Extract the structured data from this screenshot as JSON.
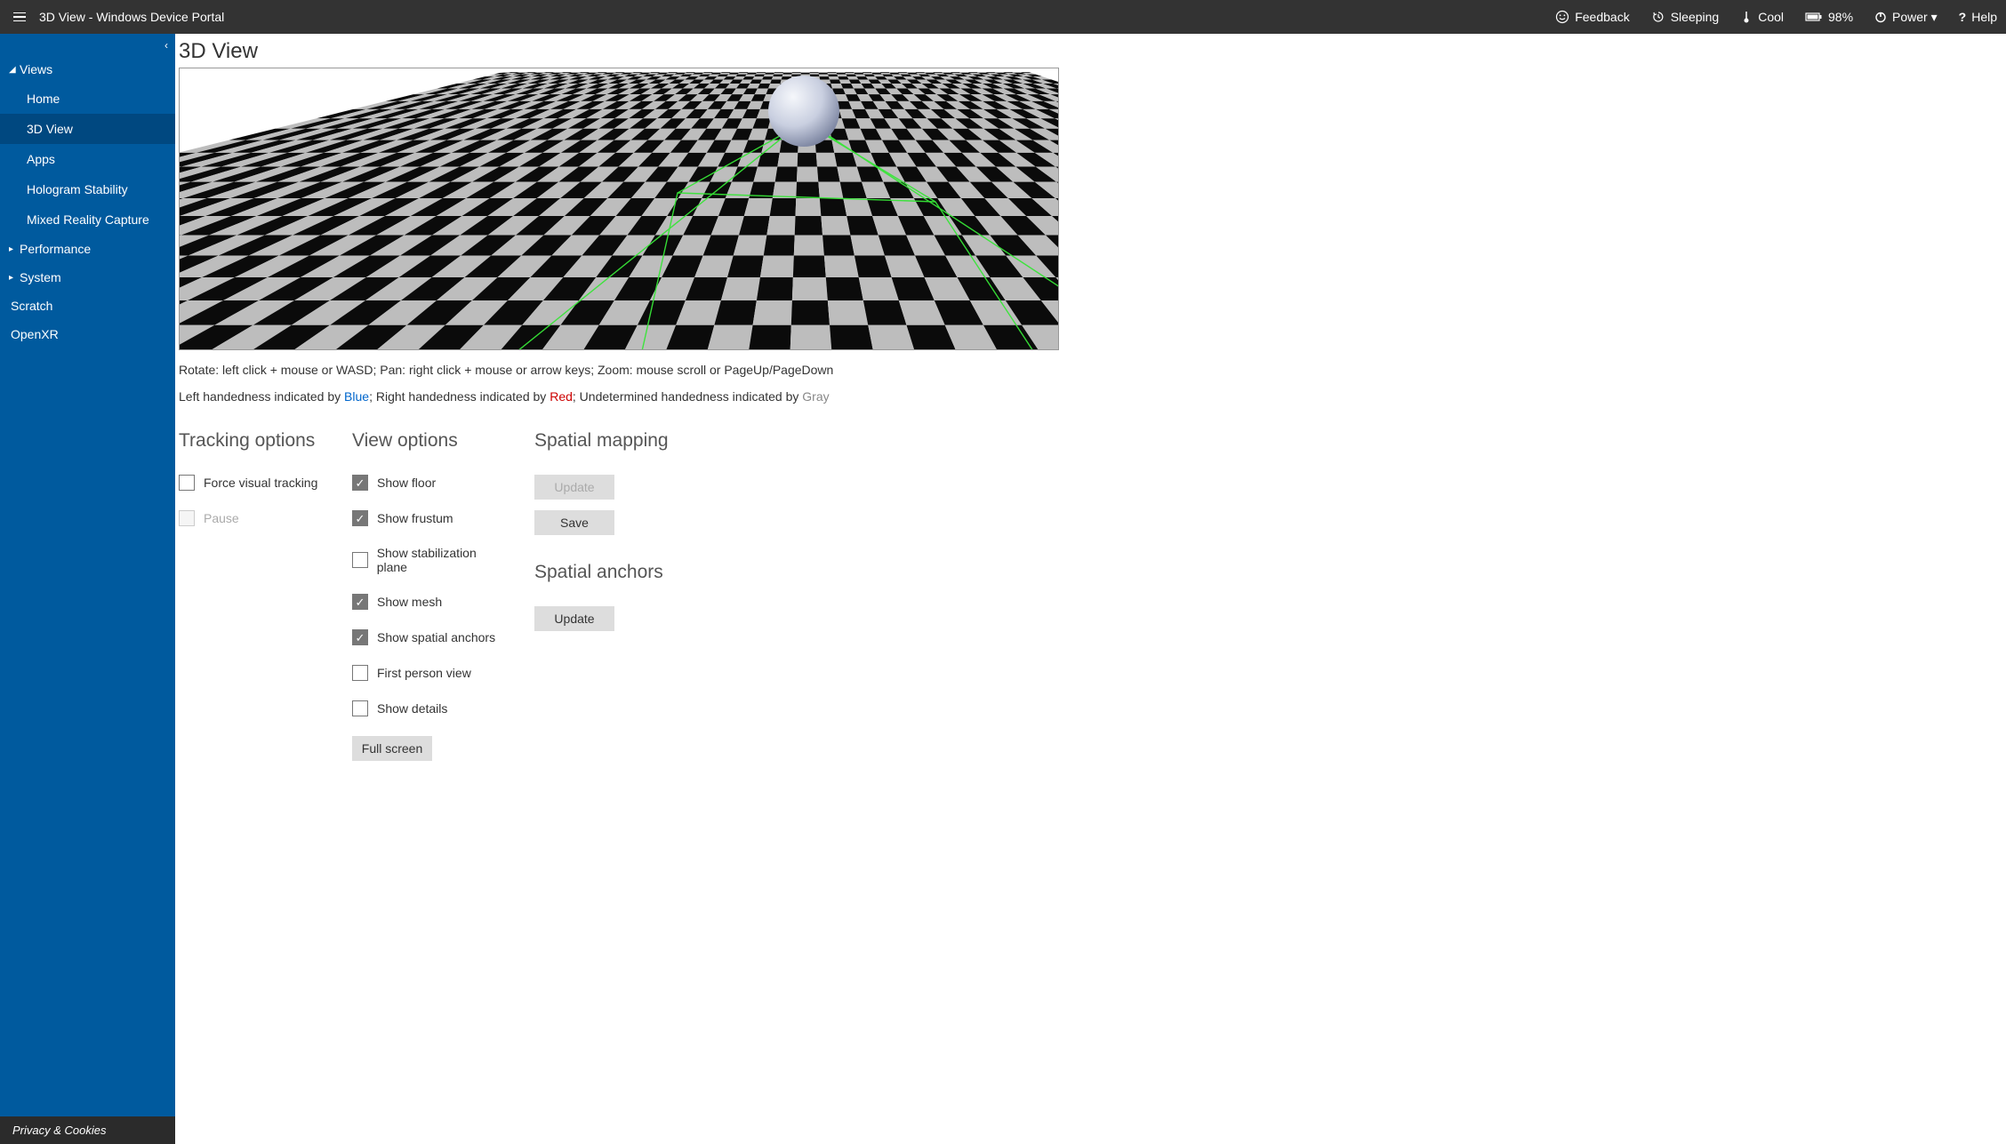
{
  "topbar": {
    "title": "3D View - Windows Device Portal",
    "feedback": "Feedback",
    "sleeping": "Sleeping",
    "cool": "Cool",
    "battery": "98%",
    "power": "Power ▾",
    "help": "Help"
  },
  "sidebar": {
    "groups": [
      {
        "label": "Views",
        "expanded": true,
        "items": [
          "Home",
          "3D View",
          "Apps",
          "Hologram Stability",
          "Mixed Reality Capture"
        ],
        "activeIndex": 1
      },
      {
        "label": "Performance",
        "expanded": false
      },
      {
        "label": "System",
        "expanded": false
      }
    ],
    "plain": [
      "Scratch",
      "OpenXR"
    ],
    "footer": "Privacy & Cookies"
  },
  "page": {
    "title": "3D View",
    "controls_help": "Rotate: left click + mouse or WASD; Pan: right click + mouse or arrow keys; Zoom: mouse scroll or PageUp/PageDown",
    "hand_pre1": "Left handedness indicated by ",
    "hand_blue": "Blue",
    "hand_mid": "; Right handedness indicated by ",
    "hand_red": "Red",
    "hand_post": "; Undetermined handedness indicated by ",
    "hand_gray": "Gray"
  },
  "tracking": {
    "title": "Tracking options",
    "force": "Force visual tracking",
    "pause": "Pause"
  },
  "view": {
    "title": "View options",
    "floor": "Show floor",
    "frustum": "Show frustum",
    "stab": "Show stabilization plane",
    "mesh": "Show mesh",
    "anchors": "Show spatial anchors",
    "fpv": "First person view",
    "details": "Show details",
    "fullscreen": "Full screen"
  },
  "spatial": {
    "mapping_title": "Spatial mapping",
    "update": "Update",
    "save": "Save",
    "anchors_title": "Spatial anchors",
    "anchors_update": "Update"
  }
}
